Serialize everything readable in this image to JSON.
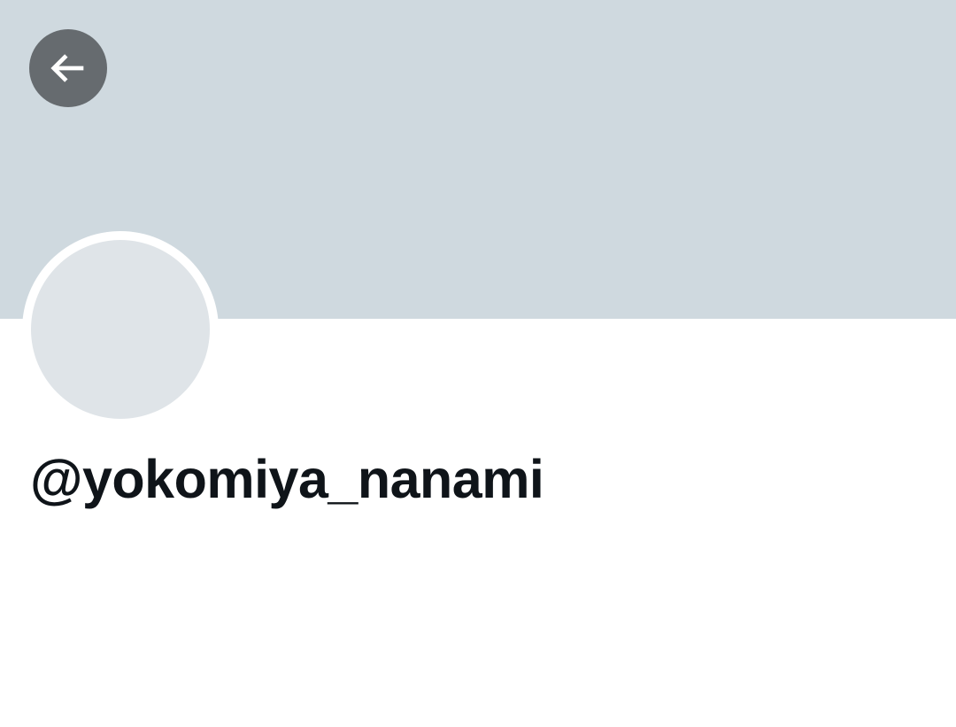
{
  "profile": {
    "handle": "@yokomiya_nanami"
  },
  "icons": {
    "back": "arrow-left-icon"
  },
  "colors": {
    "banner": "#cfd9df",
    "back_button_bg": "#666b6f",
    "avatar_placeholder": "#dfe4e8",
    "text_primary": "#0f1419",
    "background": "#ffffff"
  }
}
